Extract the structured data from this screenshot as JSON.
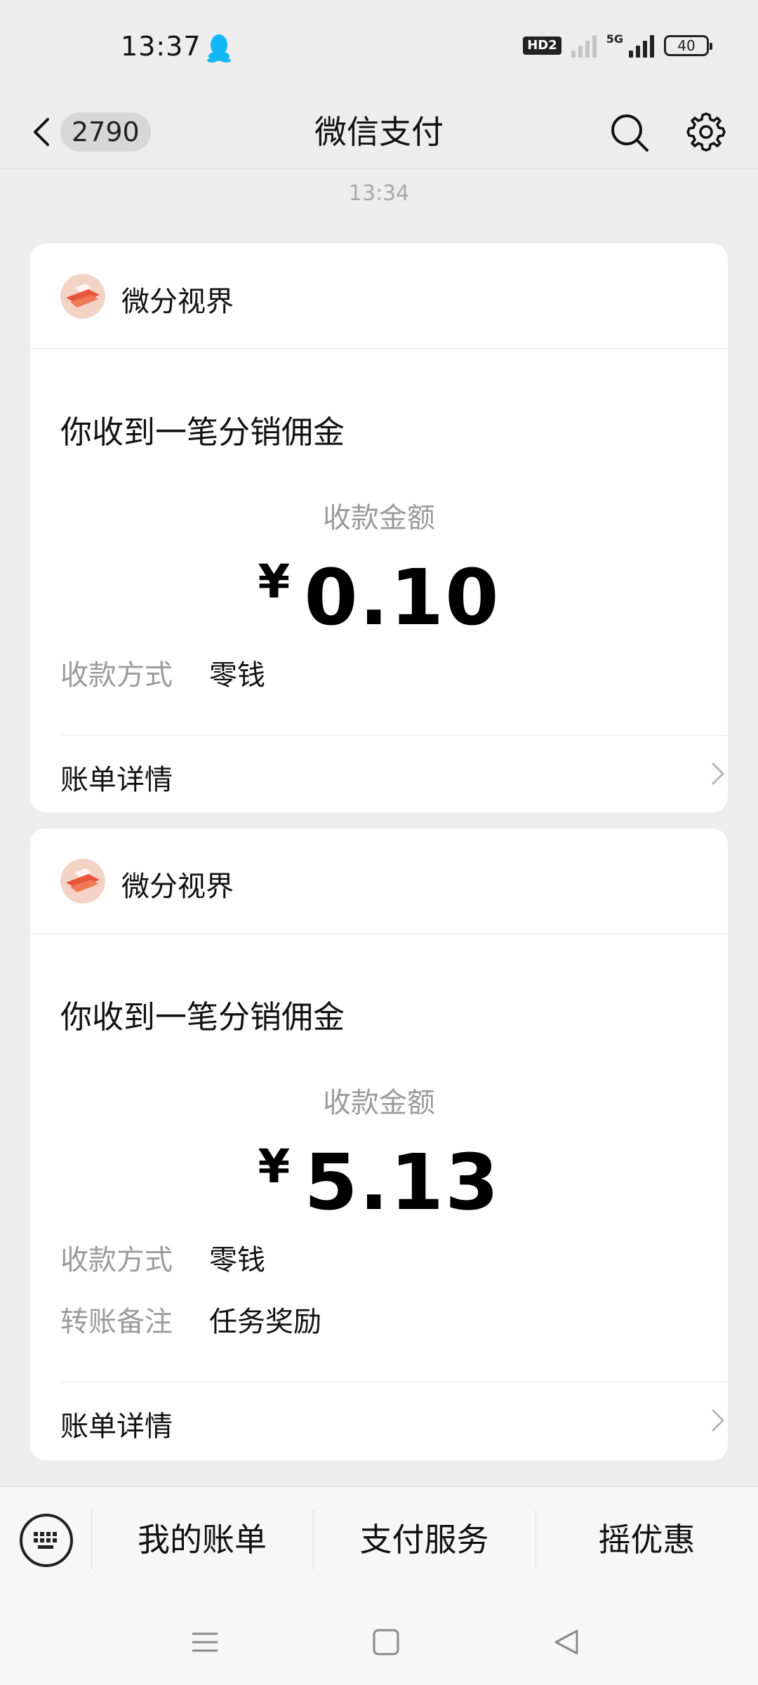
{
  "status_bar": {
    "time": "13:37",
    "hd_badge": "HD2",
    "network": "5G",
    "battery": "40"
  },
  "nav": {
    "unread_count": "2790",
    "title": "微信支付"
  },
  "chat": {
    "timestamp": "13:34"
  },
  "cards": [
    {
      "sender": "微分视界",
      "title": "你收到一笔分销佣金",
      "amount_label": "收款金额",
      "currency_symbol": "¥",
      "amount": "0.10",
      "details": [
        {
          "key": "收款方式",
          "value": "零钱"
        }
      ],
      "bill_label": "账单详情"
    },
    {
      "sender": "微分视界",
      "title": "你收到一笔分销佣金",
      "amount_label": "收款金额",
      "currency_symbol": "¥",
      "amount": "5.13",
      "details": [
        {
          "key": "收款方式",
          "value": "零钱"
        },
        {
          "key": "转账备注",
          "value": "任务奖励"
        }
      ],
      "bill_label": "账单详情"
    }
  ],
  "bottom_menu": {
    "items": [
      "我的账单",
      "支付服务",
      "摇优惠"
    ]
  },
  "icons": {
    "qq": "qq-penguin-icon",
    "back": "chevron-left-icon",
    "search": "search-icon",
    "settings": "gear-icon",
    "keyboard": "keyboard-icon",
    "chevron": "chevron-right-icon"
  },
  "colors": {
    "background": "#ededed",
    "card": "#ffffff",
    "muted_text": "#9b9b9b",
    "qq_blue": "#12b7f5"
  }
}
